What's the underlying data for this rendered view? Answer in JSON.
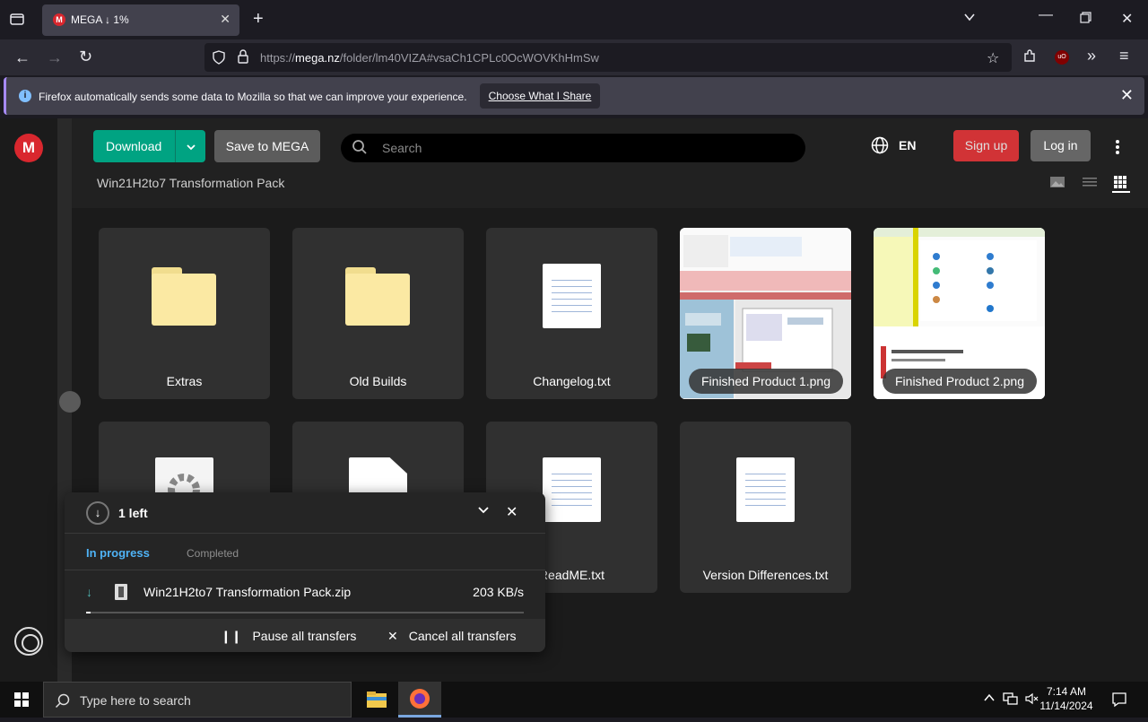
{
  "browser": {
    "tab_title": "MEGA ↓ 1%",
    "tab_favicon": "M",
    "url_prefix": "https://",
    "url_domain": "mega.nz",
    "url_rest": "/folder/lm40VIZA#vsaCh1CPLc0OcWOVKhHmSw",
    "info_text": "Firefox automatically sends some data to Mozilla so that we can improve your experience.",
    "info_button": "Choose What I Share"
  },
  "header": {
    "logo": "M",
    "download_label": "Download",
    "save_label": "Save to MEGA",
    "search_placeholder": "Search",
    "language": "EN",
    "signup_label": "Sign up",
    "login_label": "Log in",
    "folder_title": "Win21H2to7 Transformation Pack"
  },
  "files": [
    {
      "name": "Extras",
      "type": "folder"
    },
    {
      "name": "Old Builds",
      "type": "folder"
    },
    {
      "name": "Changelog.txt",
      "type": "text"
    },
    {
      "name": "Finished Product 1.png",
      "type": "image"
    },
    {
      "name": "Finished Product 2.png",
      "type": "image"
    },
    {
      "name": "",
      "type": "settings"
    },
    {
      "name": "",
      "type": "blank"
    },
    {
      "name": "ReadME.txt",
      "type": "text"
    },
    {
      "name": "Version Differences.txt",
      "type": "text"
    }
  ],
  "transfers": {
    "count_label": "1 left",
    "tab_in_progress": "In progress",
    "tab_completed": "Completed",
    "file_name": "Win21H2to7 Transformation Pack.zip",
    "speed": "203 KB/s",
    "progress_fraction": 0.01,
    "pause_label": "Pause all transfers",
    "cancel_label": "Cancel all transfers"
  },
  "taskbar": {
    "search_placeholder": "Type here to search",
    "time": "7:14 AM",
    "date": "11/14/2024"
  },
  "colors": {
    "accent_green": "#00a382",
    "mega_red": "#d9272e",
    "progress_blue": "#4fb3f6"
  }
}
